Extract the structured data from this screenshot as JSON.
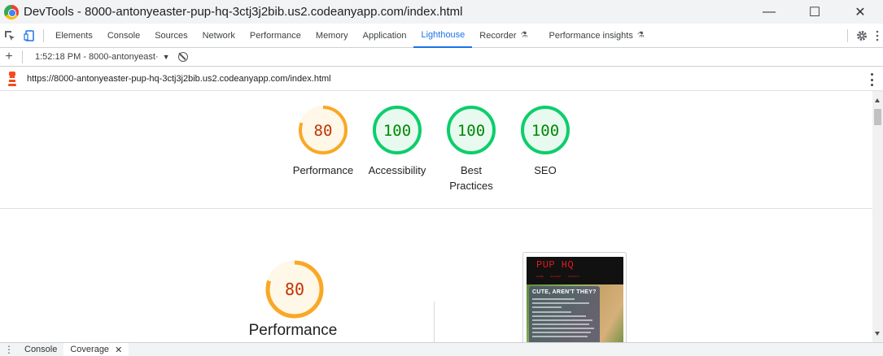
{
  "window": {
    "title": "DevTools - 8000-antonyeaster-pup-hq-3ctj3j2bib.us2.codeanyapp.com/index.html",
    "minimize_glyph": "—",
    "maximize_glyph": "☐",
    "close_glyph": "✕"
  },
  "devtools": {
    "tabs": [
      {
        "label": "Elements"
      },
      {
        "label": "Console"
      },
      {
        "label": "Sources"
      },
      {
        "label": "Network"
      },
      {
        "label": "Performance"
      },
      {
        "label": "Memory"
      },
      {
        "label": "Application"
      },
      {
        "label": "Lighthouse",
        "active": true
      },
      {
        "label": "Recorder",
        "icon": "flask-icon"
      },
      {
        "label": "Performance insights",
        "icon": "flask-icon"
      }
    ],
    "settings_icon": "gear-icon",
    "more_icon": "kebab-icon"
  },
  "toolbar": {
    "add_glyph": "+",
    "report_select": "1:52:18 PM - 8000-antonyeast·",
    "caret": "▼"
  },
  "urlbar": {
    "url": "https://8000-antonyeaster-pup-hq-3ctj3j2bib.us2.codeanyapp.com/index.html"
  },
  "scores": [
    {
      "label": "Performance",
      "value": 80,
      "color": "#f9a825",
      "text_color": "#c33300",
      "bg": "#fff7e8"
    },
    {
      "label": "Accessibility",
      "value": 100,
      "color": "#0cce6b",
      "text_color": "#008800",
      "bg": "#e8faf0"
    },
    {
      "label": "Best Practices",
      "value": 100,
      "color": "#0cce6b",
      "text_color": "#008800",
      "bg": "#e8faf0"
    },
    {
      "label": "SEO",
      "value": 100,
      "color": "#0cce6b",
      "text_color": "#008800",
      "bg": "#e8faf0"
    }
  ],
  "detail": {
    "score": 80,
    "title": "Performance",
    "color": "#f9a825",
    "text_color": "#c33300"
  },
  "screenshot": {
    "site_title": "PUP HQ",
    "nav": [
      "HOME",
      "GALLERY",
      "CONTACT"
    ],
    "card_title": "CUTE, AREN'T THEY?"
  },
  "drawer": {
    "menu_glyph": "⋮",
    "tabs": [
      {
        "label": "Console"
      },
      {
        "label": "Coverage",
        "active": true
      }
    ],
    "close_glyph": "✕"
  }
}
